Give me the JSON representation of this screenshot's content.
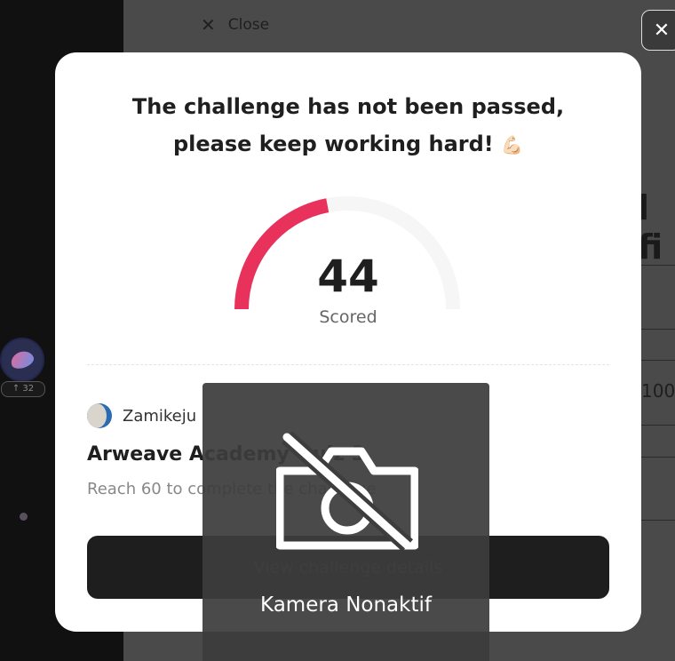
{
  "background": {
    "close_label": "Close",
    "partial_title": "l fi",
    "partial_value": "100",
    "user_badge": "↑ 32"
  },
  "modal": {
    "headline_line1": "The challenge has not been passed,",
    "headline_line2": "please keep working hard!",
    "headline_emoji": "💪🏻",
    "score_value": "44",
    "score_label": "Scored",
    "gauge_fraction": 0.44,
    "gauge_color": "#e8315b",
    "creator_name": "Zamikeju",
    "quiz_title": "Arweave Academy Quiz 3",
    "quiz_subtitle": "Reach 60 to complete the challenge",
    "cta_label": "View challenge details"
  },
  "camera_overlay": {
    "label": "Kamera Nonaktif",
    "icon": "camera-off-icon"
  }
}
